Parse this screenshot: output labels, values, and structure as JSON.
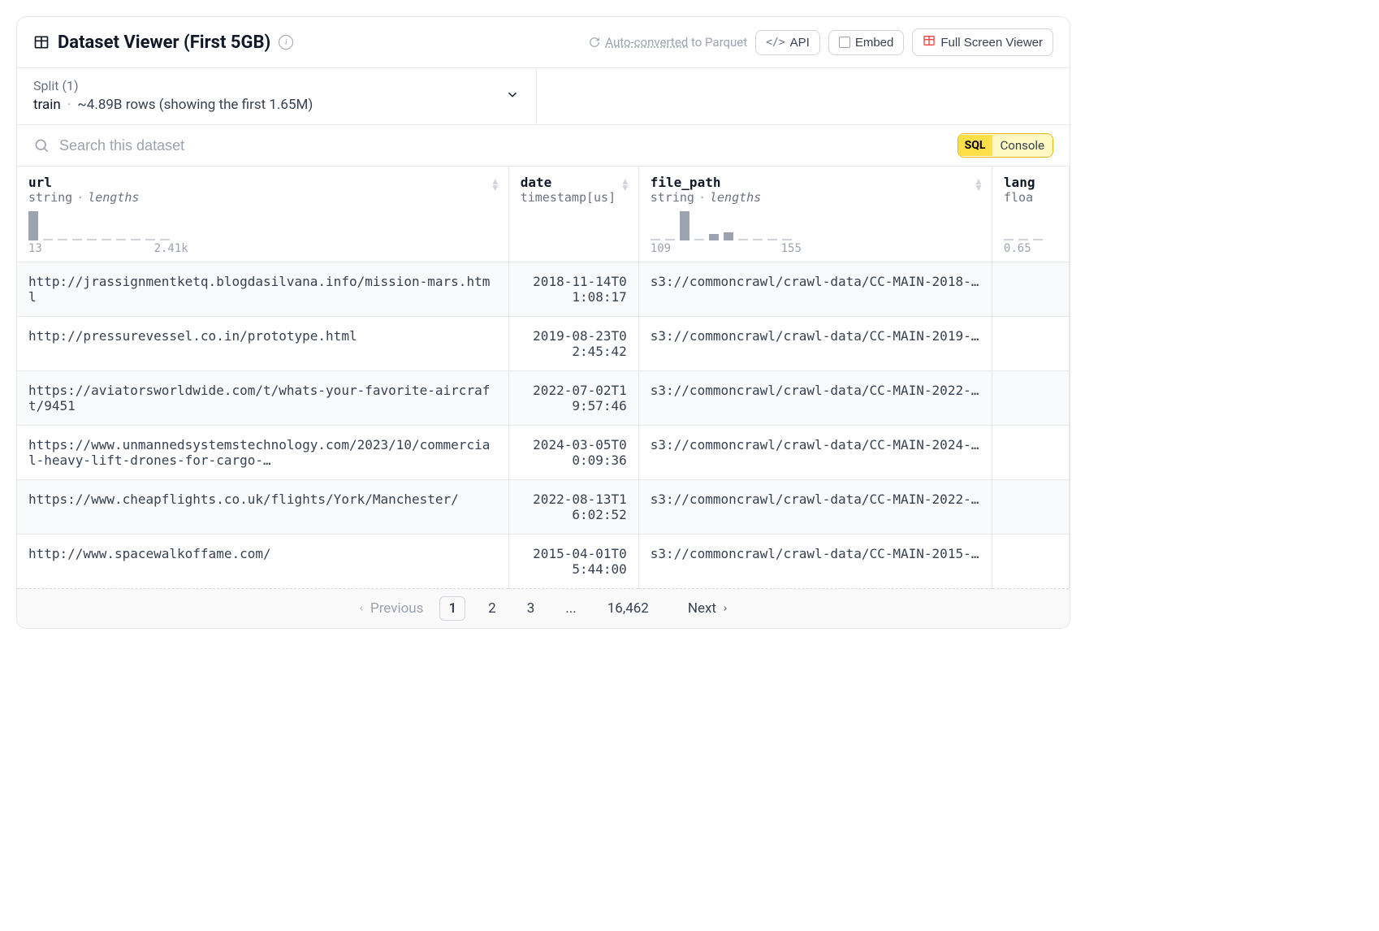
{
  "header": {
    "title": "Dataset Viewer (First 5GB)",
    "auto_converted_link": "Auto-converted",
    "auto_converted_suffix": " to Parquet",
    "api_label": "API",
    "embed_label": "Embed",
    "fullscreen_label": "Full Screen Viewer"
  },
  "split": {
    "label": "Split (1)",
    "name": "train",
    "rows": "~4.89B rows (showing the first 1.65M)"
  },
  "search": {
    "placeholder": "Search this dataset",
    "sql_label": "SQL",
    "console_label": "Console"
  },
  "columns": [
    {
      "name": "url",
      "type": "string",
      "subtype": "lengths",
      "histo_min": "13",
      "histo_max": "2.41k"
    },
    {
      "name": "date",
      "type": "timestamp[us]",
      "subtype": ""
    },
    {
      "name": "file_path",
      "type": "string",
      "subtype": "lengths",
      "histo_min": "109",
      "histo_max": "155"
    },
    {
      "name": "lang",
      "type": "floa",
      "subtype": "",
      "histo_min": "0.65"
    }
  ],
  "rows": [
    {
      "url": "http://jrassignmentketq.blogdasilvana.info/mission-mars.html",
      "date": "2018-11-14T01:08:17",
      "file_path": "s3://commoncrawl/crawl-data/CC-MAIN-2018-…"
    },
    {
      "url": "http://pressurevessel.co.in/prototype.html",
      "date": "2019-08-23T02:45:42",
      "file_path": "s3://commoncrawl/crawl-data/CC-MAIN-2019-…"
    },
    {
      "url": "https://aviatorsworldwide.com/t/whats-your-favorite-aircraft/9451",
      "date": "2022-07-02T19:57:46",
      "file_path": "s3://commoncrawl/crawl-data/CC-MAIN-2022-…"
    },
    {
      "url": "https://www.unmannedsystemstechnology.com/2023/10/commercial-heavy-lift-drones-for-cargo-…",
      "date": "2024-03-05T00:09:36",
      "file_path": "s3://commoncrawl/crawl-data/CC-MAIN-2024-…"
    },
    {
      "url": "https://www.cheapflights.co.uk/flights/York/Manchester/",
      "date": "2022-08-13T16:02:52",
      "file_path": "s3://commoncrawl/crawl-data/CC-MAIN-2022-…"
    },
    {
      "url": "http://www.spacewalkoffame.com/",
      "date": "2015-04-01T05:44:00",
      "file_path": "s3://commoncrawl/crawl-data/CC-MAIN-2015-…"
    }
  ],
  "pagination": {
    "previous": "Previous",
    "pages": [
      "1",
      "2",
      "3",
      "...",
      "16,462"
    ],
    "next": "Next",
    "active": 0
  }
}
